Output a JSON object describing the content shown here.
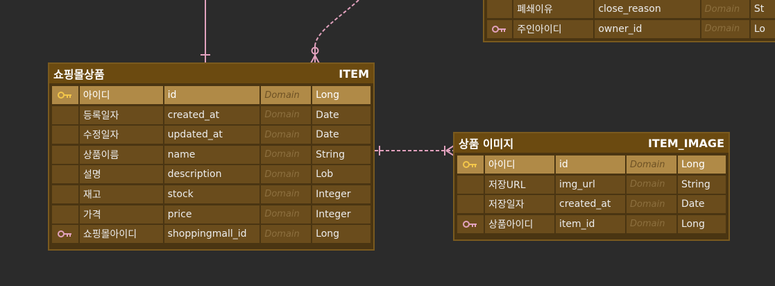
{
  "colors": {
    "background": "#2b2b2b",
    "entity_body": "#4a3512",
    "entity_header": "#6b4a10",
    "cell": "#6a4c1c",
    "pk_cell": "#b08a47",
    "domain_text": "#8c6f3e",
    "relation_line": "#e2a2be",
    "pk_key_icon": "#f3c64a",
    "fk_key_icon": "#e2a2be"
  },
  "entities": {
    "shop_top": {
      "rows": [
        {
          "kr": "폐쇄이유",
          "en": "close_reason",
          "domain": "Domain",
          "type": "St",
          "key": "none"
        },
        {
          "kr": "주인아이디",
          "en": "owner_id",
          "domain": "Domain",
          "type": "Lo",
          "key": "fk"
        }
      ]
    },
    "item": {
      "kr_title": "쇼핑몰상품",
      "en_title": "ITEM",
      "rows": [
        {
          "kr": "아이디",
          "en": "id",
          "domain": "Domain",
          "type": "Long",
          "key": "pk"
        },
        {
          "kr": "등록일자",
          "en": "created_at",
          "domain": "Domain",
          "type": "Date",
          "key": "none"
        },
        {
          "kr": "수정일자",
          "en": "updated_at",
          "domain": "Domain",
          "type": "Date",
          "key": "none"
        },
        {
          "kr": "상품이름",
          "en": "name",
          "domain": "Domain",
          "type": "String",
          "key": "none"
        },
        {
          "kr": "설명",
          "en": "description",
          "domain": "Domain",
          "type": "Lob",
          "key": "none"
        },
        {
          "kr": "재고",
          "en": "stock",
          "domain": "Domain",
          "type": "Integer",
          "key": "none"
        },
        {
          "kr": "가격",
          "en": "price",
          "domain": "Domain",
          "type": "Integer",
          "key": "none"
        },
        {
          "kr": "쇼핑몰아이디",
          "en": "shoppingmall_id",
          "domain": "Domain",
          "type": "Long",
          "key": "fk"
        }
      ]
    },
    "item_image": {
      "kr_title": "상품 이미지",
      "en_title": "ITEM_IMAGE",
      "rows": [
        {
          "kr": "아이디",
          "en": "id",
          "domain": "Domain",
          "type": "Long",
          "key": "pk"
        },
        {
          "kr": "저장URL",
          "en": "img_url",
          "domain": "Domain",
          "type": "String",
          "key": "none"
        },
        {
          "kr": "저장일자",
          "en": "created_at",
          "domain": "Domain",
          "type": "Date",
          "key": "none"
        },
        {
          "kr": "상품아이디",
          "en": "item_id",
          "domain": "Domain",
          "type": "Long",
          "key": "fk"
        }
      ]
    }
  }
}
